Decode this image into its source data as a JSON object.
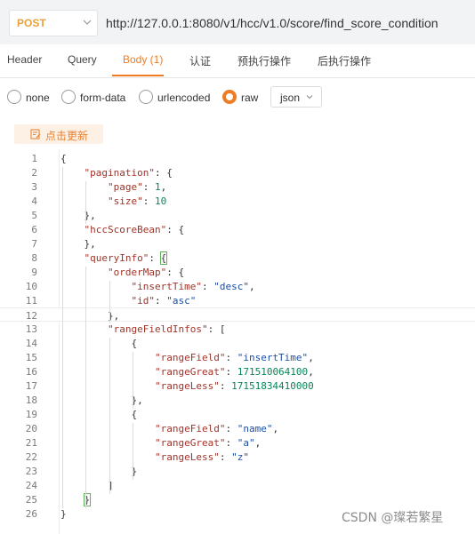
{
  "request": {
    "method": "POST",
    "url": "http://127.0.0.1:8080/v1/hcc/v1.0/score/find_score_condition"
  },
  "tabs": [
    {
      "label": "Header"
    },
    {
      "label": "Query"
    },
    {
      "label": "Body (1)",
      "active": true
    },
    {
      "label": "认证"
    },
    {
      "label": "预执行操作"
    },
    {
      "label": "后执行操作"
    }
  ],
  "body_types": [
    {
      "label": "none"
    },
    {
      "label": "form-data"
    },
    {
      "label": "urlencoded"
    },
    {
      "label": "raw",
      "checked": true
    }
  ],
  "format_select": {
    "value": "json"
  },
  "refresh_button": {
    "label": "点击更新"
  },
  "editor": {
    "current_line": 12,
    "lines": [
      {
        "n": "1",
        "tokens": [
          [
            "p",
            "{"
          ]
        ]
      },
      {
        "n": "2",
        "tokens": [
          [
            "p",
            "    "
          ],
          [
            "k",
            "\"pagination\""
          ],
          [
            "p",
            ": {"
          ]
        ]
      },
      {
        "n": "3",
        "tokens": [
          [
            "p",
            "        "
          ],
          [
            "k",
            "\"page\""
          ],
          [
            "p",
            ": "
          ],
          [
            "n",
            "1"
          ],
          [
            "p",
            ","
          ]
        ]
      },
      {
        "n": "4",
        "tokens": [
          [
            "p",
            "        "
          ],
          [
            "k",
            "\"size\""
          ],
          [
            "p",
            ": "
          ],
          [
            "n",
            "10"
          ]
        ]
      },
      {
        "n": "5",
        "tokens": [
          [
            "p",
            "    },"
          ]
        ]
      },
      {
        "n": "6",
        "tokens": [
          [
            "p",
            "    "
          ],
          [
            "k",
            "\"hccScoreBean\""
          ],
          [
            "p",
            ": {"
          ]
        ]
      },
      {
        "n": "7",
        "tokens": [
          [
            "p",
            "    },"
          ]
        ]
      },
      {
        "n": "8",
        "tokens": [
          [
            "p",
            "    "
          ],
          [
            "k",
            "\"queryInfo\""
          ],
          [
            "p",
            ": "
          ],
          [
            "b",
            "{"
          ]
        ]
      },
      {
        "n": "9",
        "tokens": [
          [
            "p",
            "        "
          ],
          [
            "k",
            "\"orderMap\""
          ],
          [
            "p",
            ": {"
          ]
        ]
      },
      {
        "n": "10",
        "tokens": [
          [
            "p",
            "            "
          ],
          [
            "k",
            "\"insertTime\""
          ],
          [
            "p",
            ": "
          ],
          [
            "s",
            "\"desc\""
          ],
          [
            "p",
            ","
          ]
        ]
      },
      {
        "n": "11",
        "tokens": [
          [
            "p",
            "            "
          ],
          [
            "k",
            "\"id\""
          ],
          [
            "p",
            ": "
          ],
          [
            "s",
            "\"asc\""
          ]
        ]
      },
      {
        "n": "12",
        "tokens": [
          [
            "p",
            "        },"
          ]
        ]
      },
      {
        "n": "13",
        "tokens": [
          [
            "p",
            "        "
          ],
          [
            "k",
            "\"rangeFieldInfos\""
          ],
          [
            "p",
            ": ["
          ]
        ]
      },
      {
        "n": "14",
        "tokens": [
          [
            "p",
            "            {"
          ]
        ]
      },
      {
        "n": "15",
        "tokens": [
          [
            "p",
            "                "
          ],
          [
            "k",
            "\"rangeField\""
          ],
          [
            "p",
            ": "
          ],
          [
            "s",
            "\"insertTime\""
          ],
          [
            "p",
            ","
          ]
        ]
      },
      {
        "n": "16",
        "tokens": [
          [
            "p",
            "                "
          ],
          [
            "k",
            "\"rangeGreat\""
          ],
          [
            "p",
            ": "
          ],
          [
            "n",
            "171510064100"
          ],
          [
            "p",
            ","
          ]
        ]
      },
      {
        "n": "17",
        "tokens": [
          [
            "p",
            "                "
          ],
          [
            "k",
            "\"rangeLess\""
          ],
          [
            "p",
            ": "
          ],
          [
            "n",
            "17151834410000"
          ]
        ]
      },
      {
        "n": "18",
        "tokens": [
          [
            "p",
            "            },"
          ]
        ]
      },
      {
        "n": "19",
        "tokens": [
          [
            "p",
            "            {"
          ]
        ]
      },
      {
        "n": "20",
        "tokens": [
          [
            "p",
            "                "
          ],
          [
            "k",
            "\"rangeField\""
          ],
          [
            "p",
            ": "
          ],
          [
            "s",
            "\"name\""
          ],
          [
            "p",
            ","
          ]
        ]
      },
      {
        "n": "21",
        "tokens": [
          [
            "p",
            "                "
          ],
          [
            "k",
            "\"rangeGreat\""
          ],
          [
            "p",
            ": "
          ],
          [
            "s",
            "\"a\""
          ],
          [
            "p",
            ","
          ]
        ]
      },
      {
        "n": "22",
        "tokens": [
          [
            "p",
            "                "
          ],
          [
            "k",
            "\"rangeLess\""
          ],
          [
            "p",
            ": "
          ],
          [
            "s",
            "\"z\""
          ]
        ]
      },
      {
        "n": "23",
        "tokens": [
          [
            "p",
            "            }"
          ]
        ]
      },
      {
        "n": "24",
        "tokens": [
          [
            "p",
            "        ]"
          ]
        ]
      },
      {
        "n": "25",
        "tokens": [
          [
            "p",
            "    "
          ],
          [
            "b",
            "}"
          ]
        ]
      },
      {
        "n": "26",
        "tokens": [
          [
            "p",
            "}"
          ]
        ]
      }
    ]
  },
  "watermark": "CSDN @璨若繁星",
  "colors": {
    "accent": "#f07b21",
    "method": "#e8a23d",
    "json_key": "#a1342a",
    "json_string": "#1c4fa3",
    "json_number": "#098658"
  }
}
